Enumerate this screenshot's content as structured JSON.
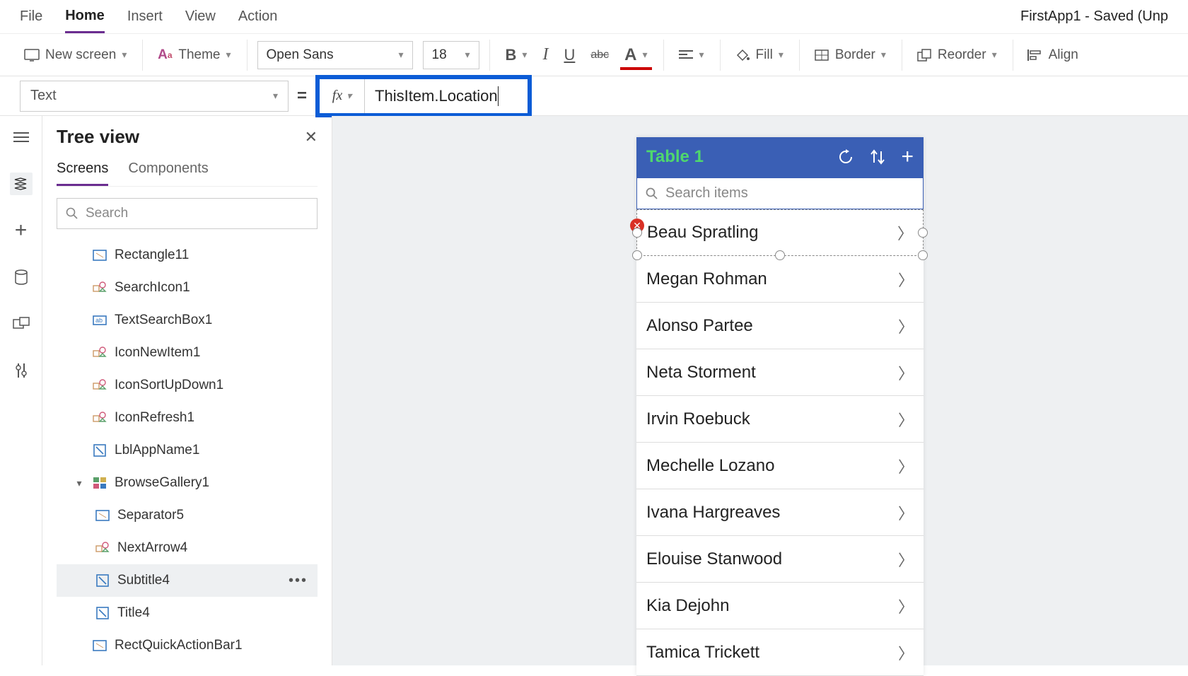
{
  "app_title": "FirstApp1 - Saved (Unp",
  "menubar": [
    "File",
    "Home",
    "Insert",
    "View",
    "Action"
  ],
  "menubar_active": "Home",
  "ribbon": {
    "new_screen": "New screen",
    "theme": "Theme",
    "font_family": "Open Sans",
    "font_size": "18",
    "fill": "Fill",
    "border": "Border",
    "reorder": "Reorder",
    "align": "Align"
  },
  "property_selector": "Text",
  "formula": "ThisItem.Location",
  "panel": {
    "title": "Tree view",
    "tabs": [
      "Screens",
      "Components"
    ],
    "tabs_active": "Screens",
    "search_placeholder": "Search"
  },
  "tree": {
    "items": [
      {
        "icon": "rect",
        "label": "Rectangle11"
      },
      {
        "icon": "iconctrl",
        "label": "SearchIcon1"
      },
      {
        "icon": "textbox",
        "label": "TextSearchBox1"
      },
      {
        "icon": "iconctrl",
        "label": "IconNewItem1"
      },
      {
        "icon": "iconctrl",
        "label": "IconSortUpDown1"
      },
      {
        "icon": "iconctrl",
        "label": "IconRefresh1"
      },
      {
        "icon": "label",
        "label": "LblAppName1"
      },
      {
        "icon": "gallery",
        "label": "BrowseGallery1",
        "expanded": true
      },
      {
        "icon": "rect",
        "label": "Separator5",
        "nested": true
      },
      {
        "icon": "iconctrl",
        "label": "NextArrow4",
        "nested": true
      },
      {
        "icon": "label",
        "label": "Subtitle4",
        "nested": true,
        "selected": true
      },
      {
        "icon": "label",
        "label": "Title4",
        "nested": true
      },
      {
        "icon": "rect",
        "label": "RectQuickActionBar1"
      }
    ]
  },
  "app_preview": {
    "title": "Table 1",
    "search_placeholder": "Search items",
    "rows": [
      "Beau Spratling",
      "Megan Rohman",
      "Alonso Partee",
      "Neta Storment",
      "Irvin Roebuck",
      "Mechelle Lozano",
      "Ivana Hargreaves",
      "Elouise Stanwood",
      "Kia Dejohn",
      "Tamica Trickett"
    ],
    "selected_index": 0
  }
}
